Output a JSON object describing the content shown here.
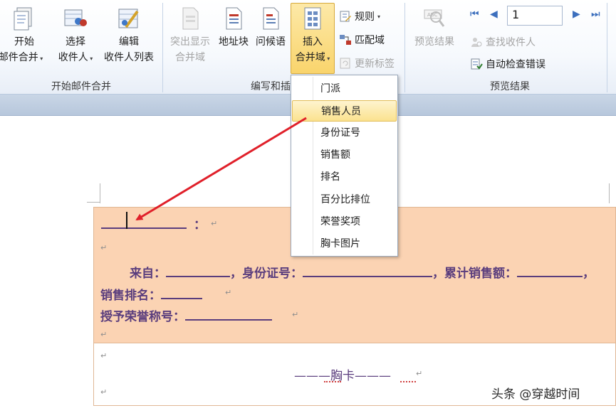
{
  "ribbon": {
    "group_start": {
      "label": "开始邮件合并",
      "start_btn": [
        "开始",
        "邮件合并"
      ],
      "select_btn": [
        "选择",
        "收件人"
      ],
      "edit_btn": [
        "编辑",
        "收件人列表"
      ]
    },
    "group_write": {
      "label": "编写和插",
      "highlight_btn": [
        "突出显示",
        "合并域"
      ],
      "address_btn": "地址块",
      "greeting_btn": "问候语",
      "insert_btn": [
        "插入",
        "合并域"
      ],
      "rules": "规则",
      "match": "匹配域",
      "update": "更新标签"
    },
    "group_preview": {
      "label": "预览结果",
      "preview_btn": "预览结果",
      "record_no": "1",
      "find": "查找收件人",
      "check": "自动检查错误"
    }
  },
  "dropdown": {
    "items": [
      "门派",
      "销售人员",
      "身份证号",
      "销售额",
      "排名",
      "百分比排位",
      "荣誉奖项",
      "胸卡图片"
    ],
    "highlighted": 1
  },
  "document": {
    "line1_colon": "：",
    "line3": [
      "来自：",
      "，身份证号：",
      "，累计销售额：",
      "，"
    ],
    "line4": "销售排名：",
    "line5": "授予荣誉称号：",
    "card_title": "———胸卡———"
  },
  "watermark": "头条 @穿越时间"
}
